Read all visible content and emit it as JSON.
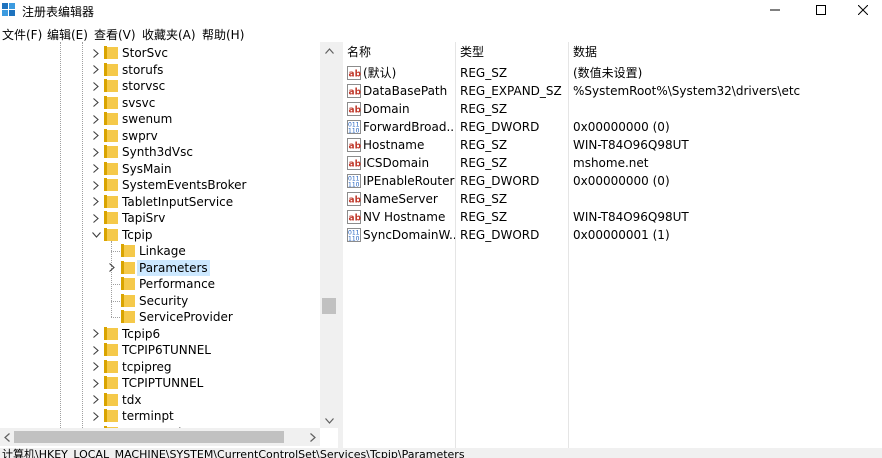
{
  "window": {
    "title": "注册表编辑器"
  },
  "menu": [
    "文件(F)",
    "编辑(E)",
    "查看(V)",
    "收藏夹(A)",
    "帮助(H)"
  ],
  "tree": {
    "items": [
      {
        "label": "StorSvc",
        "level": 0,
        "expander": "right"
      },
      {
        "label": "storufs",
        "level": 0,
        "expander": "right"
      },
      {
        "label": "storvsc",
        "level": 0,
        "expander": "right"
      },
      {
        "label": "svsvc",
        "level": 0,
        "expander": "right"
      },
      {
        "label": "swenum",
        "level": 0,
        "expander": "right"
      },
      {
        "label": "swprv",
        "level": 0,
        "expander": "right"
      },
      {
        "label": "Synth3dVsc",
        "level": 0,
        "expander": "right"
      },
      {
        "label": "SysMain",
        "level": 0,
        "expander": "right"
      },
      {
        "label": "SystemEventsBroker",
        "level": 0,
        "expander": "right"
      },
      {
        "label": "TabletInputService",
        "level": 0,
        "expander": "right"
      },
      {
        "label": "TapiSrv",
        "level": 0,
        "expander": "right"
      },
      {
        "label": "Tcpip",
        "level": 0,
        "expander": "down"
      },
      {
        "label": "Linkage",
        "level": 1,
        "expander": "none"
      },
      {
        "label": "Parameters",
        "level": 1,
        "expander": "right",
        "selected": true
      },
      {
        "label": "Performance",
        "level": 1,
        "expander": "none"
      },
      {
        "label": "Security",
        "level": 1,
        "expander": "none"
      },
      {
        "label": "ServiceProvider",
        "level": 1,
        "expander": "none"
      },
      {
        "label": "Tcpip6",
        "level": 0,
        "expander": "right"
      },
      {
        "label": "TCPIP6TUNNEL",
        "level": 0,
        "expander": "right"
      },
      {
        "label": "tcpipreg",
        "level": 0,
        "expander": "right"
      },
      {
        "label": "TCPIPTUNNEL",
        "level": 0,
        "expander": "right"
      },
      {
        "label": "tdx",
        "level": 0,
        "expander": "right"
      },
      {
        "label": "terminpt",
        "level": 0,
        "expander": "right"
      },
      {
        "label": "TermService",
        "level": 0,
        "expander": "right"
      }
    ]
  },
  "values": {
    "headers": {
      "name": "名称",
      "type": "类型",
      "data": "数据"
    },
    "rows": [
      {
        "icon": "string-value-icon",
        "name": "(默认)",
        "type": "REG_SZ",
        "data": "(数值未设置)"
      },
      {
        "icon": "string-value-icon",
        "name": "DataBasePath",
        "type": "REG_EXPAND_SZ",
        "data": "%SystemRoot%\\System32\\drivers\\etc"
      },
      {
        "icon": "string-value-icon",
        "name": "Domain",
        "type": "REG_SZ",
        "data": ""
      },
      {
        "icon": "binary-value-icon",
        "name": "ForwardBroad...",
        "type": "REG_DWORD",
        "data": "0x00000000 (0)"
      },
      {
        "icon": "string-value-icon",
        "name": "Hostname",
        "type": "REG_SZ",
        "data": "WIN-T84O96Q98UT"
      },
      {
        "icon": "string-value-icon",
        "name": "ICSDomain",
        "type": "REG_SZ",
        "data": "mshome.net"
      },
      {
        "icon": "binary-value-icon",
        "name": "IPEnableRouter",
        "type": "REG_DWORD",
        "data": "0x00000000 (0)"
      },
      {
        "icon": "string-value-icon",
        "name": "NameServer",
        "type": "REG_SZ",
        "data": ""
      },
      {
        "icon": "string-value-icon",
        "name": "NV Hostname",
        "type": "REG_SZ",
        "data": "WIN-T84O96Q98UT"
      },
      {
        "icon": "binary-value-icon",
        "name": "SyncDomainW...",
        "type": "REG_DWORD",
        "data": "0x00000001 (1)"
      }
    ]
  },
  "status": {
    "path": "计算机\\HKEY_LOCAL_MACHINE\\SYSTEM\\CurrentControlSet\\Services\\Tcpip\\Parameters"
  }
}
